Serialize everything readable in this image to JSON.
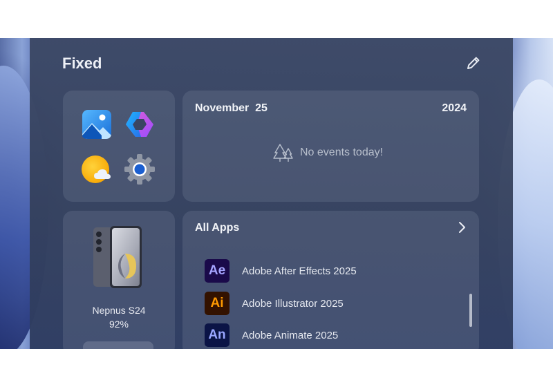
{
  "panel": {
    "title": "Fixed",
    "edit_icon": "pencil-icon"
  },
  "quick_apps": [
    {
      "icon": "photos-icon"
    },
    {
      "icon": "copilot-icon"
    },
    {
      "icon": "weather-icon"
    },
    {
      "icon": "settings-gear-icon"
    }
  ],
  "calendar": {
    "date": "November  25",
    "year": "2024",
    "empty_icon": "trees-icon",
    "empty_text": "No events today!"
  },
  "device": {
    "name": "Nepnus S24",
    "battery": "92%"
  },
  "all_apps": {
    "title": "All Apps",
    "chevron_icon": "chevron-right-icon",
    "items": [
      {
        "abbr": "Ae",
        "label": "Adobe After Effects 2025",
        "color": "#a5a4ff",
        "bg": "#1a0a4a"
      },
      {
        "abbr": "Ai",
        "label": "Adobe Illustrator 2025",
        "color": "#ff9a00",
        "bg": "#331200"
      },
      {
        "abbr": "An",
        "label": "Adobe Animate 2025",
        "color": "#99a6ff",
        "bg": "#0b1446"
      }
    ]
  }
}
